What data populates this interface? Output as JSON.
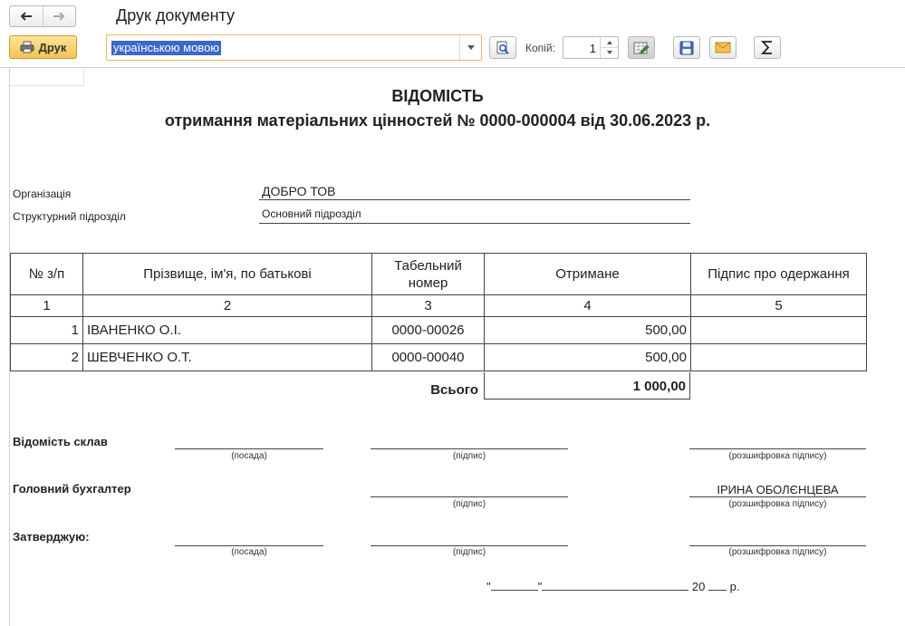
{
  "window": {
    "title": "Друк документу"
  },
  "toolbar": {
    "print_label": "Друк",
    "language_value": "українською мовою",
    "copies_label": "Копій:",
    "copies_value": "1"
  },
  "document": {
    "title": "ВІДОМІСТЬ",
    "subtitle": "отримання матеріальних цінностей № 0000-000004 від 30.06.2023 р.",
    "organization_label": "Організація",
    "organization_value": "ДОБРО ТОВ",
    "department_label": "Структурний підрозділ",
    "department_value": "Основний підрозділ",
    "table": {
      "headers": [
        "№ з/п",
        "Прізвище, ім'я, по батькові",
        "Табельний номер",
        "Отримане",
        "Підпис про одержання"
      ],
      "column_numbers": [
        "1",
        "2",
        "3",
        "4",
        "5"
      ],
      "rows": [
        {
          "n": "1",
          "name": "ІВАНЕНКО О.І.",
          "tab": "0000-00026",
          "amount": "500,00",
          "sign": ""
        },
        {
          "n": "2",
          "name": "ШЕВЧЕНКО О.Т.",
          "tab": "0000-00040",
          "amount": "500,00",
          "sign": ""
        }
      ],
      "total_label": "Всього",
      "total_value": "1 000,00"
    },
    "signatures": {
      "s1_title": "Відомість склав",
      "s2_title": "Головний бухгалтер",
      "s2_name": "ІРИНА ОБОЛЄНЦЕВА",
      "s3_title": "Затверджую:",
      "cap_position": "(посада)",
      "cap_sign": "(підпис)",
      "cap_decode": "(розшифровка підпису)"
    },
    "date_line": {
      "q1": "\"",
      "q2": "\"",
      "year_prefix": "20",
      "suffix": "р."
    }
  }
}
